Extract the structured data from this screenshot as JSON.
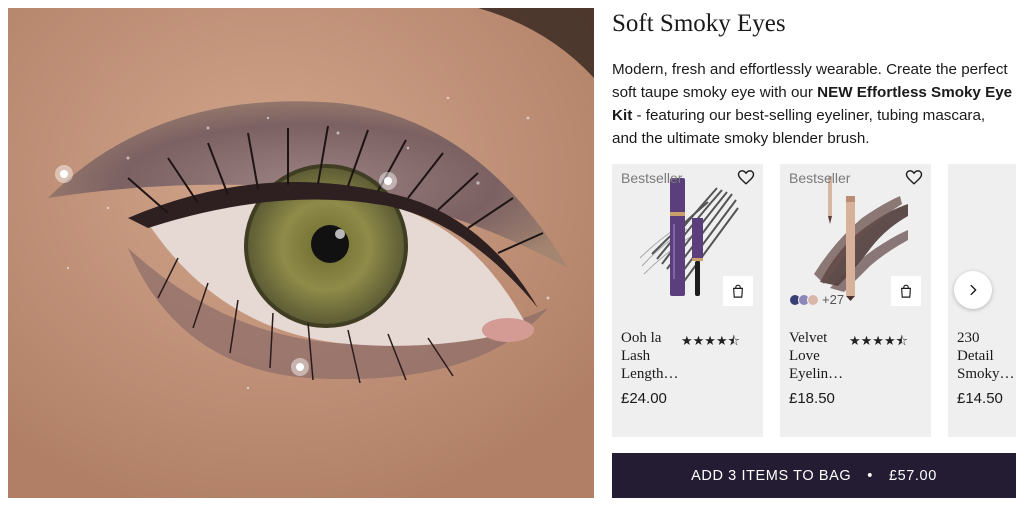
{
  "look": {
    "title": "Soft Smoky Eyes",
    "description_intro": "Modern, fresh and effortlessly wearable. Create the perfect soft taupe smoky eye with our ",
    "description_bold": "NEW Effortless Smoky Eye Kit",
    "description_outro": " - featuring our best-selling eyeliner, tubing mascara, and the ultimate smoky blender brush.",
    "image_icon": "eye-makeup-photo"
  },
  "products": [
    {
      "badge": "Bestseller",
      "name": "Ooh la Lash Length…",
      "price": "£24.00",
      "rating": 4.5,
      "stars_text": "★★★★⯪",
      "icon": "mascara"
    },
    {
      "badge": "Bestseller",
      "name": "Velvet Love Eyelin…",
      "price": "£18.50",
      "rating": 4.5,
      "stars_text": "★★★★⯪",
      "swatch_colors": [
        "#3a3f78",
        "#8a86b8",
        "#d9b7a8"
      ],
      "swatch_more": "+27",
      "icon": "eyeliner-pencil"
    },
    {
      "badge": "",
      "name": "230 Detail Smoky…",
      "price": "£14.50",
      "icon": "brush"
    }
  ],
  "bag_button": {
    "label": "ADD 3 ITEMS TO BAG",
    "separator": "•",
    "total": "£57.00"
  },
  "colors": {
    "button_bg": "#231c33",
    "card_bg": "#efefef",
    "mascara_purple": "#5a3f7c",
    "gold": "#c9a06a"
  }
}
